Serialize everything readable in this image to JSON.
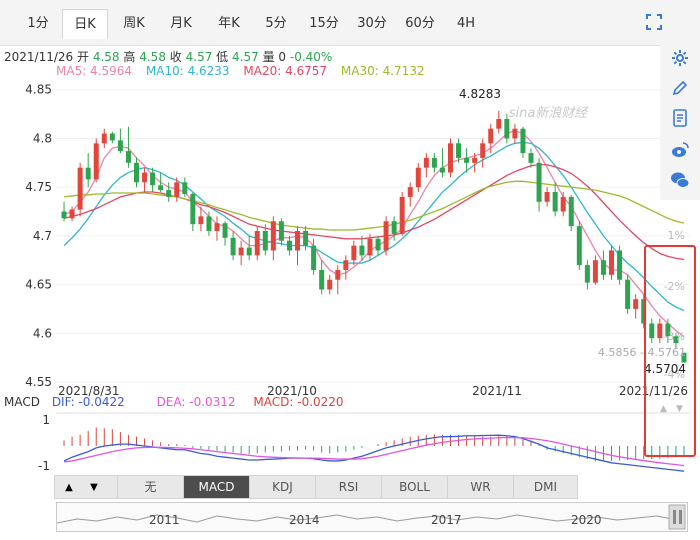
{
  "tabs": [
    {
      "label": "1分",
      "active": false
    },
    {
      "label": "日K",
      "active": true
    },
    {
      "label": "周K",
      "active": false
    },
    {
      "label": "月K",
      "active": false
    },
    {
      "label": "年K",
      "active": false
    },
    {
      "label": "5分",
      "active": false
    },
    {
      "label": "15分",
      "active": false
    },
    {
      "label": "30分",
      "active": false
    },
    {
      "label": "60分",
      "active": false
    },
    {
      "label": "4H",
      "active": false
    }
  ],
  "info": {
    "date": "2021/11/26",
    "open_label": "开",
    "open": "4.58",
    "high_label": "高",
    "high": "4.58",
    "close_label": "收",
    "close": "4.57",
    "low_label": "低",
    "low": "4.57",
    "vol_label": "量",
    "vol": "0",
    "change": "-0.40%"
  },
  "ma_legend": [
    {
      "text": "MA5: 4.5964",
      "color": "#ee82a8"
    },
    {
      "text": "MA10: 4.6233",
      "color": "#2fb6d3"
    },
    {
      "text": "MA20: 4.6757",
      "color": "#e24763"
    },
    {
      "text": "MA30: 4.7132",
      "color": "#9bbb2c"
    }
  ],
  "sidebar_icons": [
    "settings-icon",
    "pencil-icon",
    "document-icon",
    "weibo-icon",
    "wechat-icon"
  ],
  "watermark": "sina新浪财经",
  "price_axis": {
    "ticks": [
      "4.85",
      "4.8",
      "4.75",
      "4.7",
      "4.65",
      "4.6",
      "4.55"
    ],
    "values": [
      4.85,
      4.8,
      4.75,
      4.7,
      4.65,
      4.6,
      4.55
    ]
  },
  "pct_labels": [
    "1%",
    "-2%",
    "-3%",
    "-4%"
  ],
  "date_labels": [
    "2021/8/31",
    "2021/10",
    "2021/11",
    "2021/11/26"
  ],
  "annotations": {
    "high": "4.8283",
    "low": "4.5704",
    "last": "4.5856 - 4.5761"
  },
  "macd_legend": {
    "title": "MACD",
    "dif": {
      "text": "DIF: -0.0422",
      "color": "#3a5bd9"
    },
    "dea": {
      "text": "DEA: -0.0312",
      "color": "#e055e0"
    },
    "macd": {
      "text": "MACD: -0.0220",
      "color": "#d9443a"
    }
  },
  "macd_axis": [
    "1",
    "-1"
  ],
  "indicator_tabs": [
    {
      "label": "无",
      "active": false
    },
    {
      "label": "MACD",
      "active": true
    },
    {
      "label": "KDJ",
      "active": false
    },
    {
      "label": "RSI",
      "active": false
    },
    {
      "label": "BOLL",
      "active": false
    },
    {
      "label": "WR",
      "active": false
    },
    {
      "label": "DMI",
      "active": false
    }
  ],
  "nav_buttons": [
    "▲",
    "▼"
  ],
  "navigator_years": [
    "2011",
    "2014",
    "2017",
    "2020"
  ],
  "chart_data": {
    "type": "candlestick",
    "ylim": [
      4.55,
      4.86
    ],
    "up_color": "#e0463c",
    "down_color": "#2ea44f",
    "candles": [
      {
        "o": 4.725,
        "h": 4.735,
        "l": 4.715,
        "c": 4.718
      },
      {
        "o": 4.718,
        "h": 4.73,
        "l": 4.715,
        "c": 4.727
      },
      {
        "o": 4.727,
        "h": 4.775,
        "l": 4.72,
        "c": 4.77
      },
      {
        "o": 4.77,
        "h": 4.785,
        "l": 4.75,
        "c": 4.758
      },
      {
        "o": 4.758,
        "h": 4.8,
        "l": 4.755,
        "c": 4.795
      },
      {
        "o": 4.795,
        "h": 4.81,
        "l": 4.79,
        "c": 4.805
      },
      {
        "o": 4.805,
        "h": 4.807,
        "l": 4.795,
        "c": 4.798
      },
      {
        "o": 4.798,
        "h": 4.81,
        "l": 4.785,
        "c": 4.787
      },
      {
        "o": 4.787,
        "h": 4.812,
        "l": 4.77,
        "c": 4.775
      },
      {
        "o": 4.775,
        "h": 4.78,
        "l": 4.75,
        "c": 4.755
      },
      {
        "o": 4.755,
        "h": 4.77,
        "l": 4.745,
        "c": 4.765
      },
      {
        "o": 4.765,
        "h": 4.77,
        "l": 4.745,
        "c": 4.752
      },
      {
        "o": 4.752,
        "h": 4.765,
        "l": 4.745,
        "c": 4.747
      },
      {
        "o": 4.747,
        "h": 4.755,
        "l": 4.735,
        "c": 4.74
      },
      {
        "o": 4.74,
        "h": 4.76,
        "l": 4.735,
        "c": 4.755
      },
      {
        "o": 4.755,
        "h": 4.76,
        "l": 4.74,
        "c": 4.743
      },
      {
        "o": 4.743,
        "h": 4.745,
        "l": 4.705,
        "c": 4.712
      },
      {
        "o": 4.712,
        "h": 4.73,
        "l": 4.705,
        "c": 4.72
      },
      {
        "o": 4.72,
        "h": 4.725,
        "l": 4.7,
        "c": 4.705
      },
      {
        "o": 4.705,
        "h": 4.72,
        "l": 4.695,
        "c": 4.713
      },
      {
        "o": 4.713,
        "h": 4.715,
        "l": 4.69,
        "c": 4.698
      },
      {
        "o": 4.698,
        "h": 4.705,
        "l": 4.675,
        "c": 4.68
      },
      {
        "o": 4.68,
        "h": 4.695,
        "l": 4.67,
        "c": 4.688
      },
      {
        "o": 4.688,
        "h": 4.7,
        "l": 4.675,
        "c": 4.68
      },
      {
        "o": 4.68,
        "h": 4.71,
        "l": 4.675,
        "c": 4.705
      },
      {
        "o": 4.705,
        "h": 4.712,
        "l": 4.68,
        "c": 4.685
      },
      {
        "o": 4.685,
        "h": 4.72,
        "l": 4.675,
        "c": 4.715
      },
      {
        "o": 4.715,
        "h": 4.718,
        "l": 4.69,
        "c": 4.695
      },
      {
        "o": 4.695,
        "h": 4.7,
        "l": 4.68,
        "c": 4.685
      },
      {
        "o": 4.685,
        "h": 4.71,
        "l": 4.67,
        "c": 4.705
      },
      {
        "o": 4.705,
        "h": 4.71,
        "l": 4.685,
        "c": 4.69
      },
      {
        "o": 4.69,
        "h": 4.697,
        "l": 4.66,
        "c": 4.665
      },
      {
        "o": 4.665,
        "h": 4.675,
        "l": 4.64,
        "c": 4.645
      },
      {
        "o": 4.645,
        "h": 4.66,
        "l": 4.64,
        "c": 4.655
      },
      {
        "o": 4.655,
        "h": 4.67,
        "l": 4.64,
        "c": 4.665
      },
      {
        "o": 4.665,
        "h": 4.68,
        "l": 4.655,
        "c": 4.675
      },
      {
        "o": 4.675,
        "h": 4.695,
        "l": 4.67,
        "c": 4.69
      },
      {
        "o": 4.69,
        "h": 4.7,
        "l": 4.675,
        "c": 4.68
      },
      {
        "o": 4.68,
        "h": 4.702,
        "l": 4.675,
        "c": 4.697
      },
      {
        "o": 4.697,
        "h": 4.7,
        "l": 4.68,
        "c": 4.685
      },
      {
        "o": 4.685,
        "h": 4.72,
        "l": 4.68,
        "c": 4.715
      },
      {
        "o": 4.715,
        "h": 4.72,
        "l": 4.695,
        "c": 4.702
      },
      {
        "o": 4.702,
        "h": 4.745,
        "l": 4.7,
        "c": 4.74
      },
      {
        "o": 4.74,
        "h": 4.755,
        "l": 4.73,
        "c": 4.75
      },
      {
        "o": 4.75,
        "h": 4.775,
        "l": 4.745,
        "c": 4.77
      },
      {
        "o": 4.77,
        "h": 4.785,
        "l": 4.76,
        "c": 4.78
      },
      {
        "o": 4.78,
        "h": 4.785,
        "l": 4.765,
        "c": 4.77
      },
      {
        "o": 4.77,
        "h": 4.79,
        "l": 4.76,
        "c": 4.765
      },
      {
        "o": 4.765,
        "h": 4.8,
        "l": 4.76,
        "c": 4.795
      },
      {
        "o": 4.795,
        "h": 4.8,
        "l": 4.775,
        "c": 4.78
      },
      {
        "o": 4.78,
        "h": 4.79,
        "l": 4.765,
        "c": 4.775
      },
      {
        "o": 4.775,
        "h": 4.785,
        "l": 4.765,
        "c": 4.78
      },
      {
        "o": 4.78,
        "h": 4.8,
        "l": 4.77,
        "c": 4.795
      },
      {
        "o": 4.795,
        "h": 4.815,
        "l": 4.785,
        "c": 4.81
      },
      {
        "o": 4.81,
        "h": 4.8283,
        "l": 4.805,
        "c": 4.82
      },
      {
        "o": 4.82,
        "h": 4.825,
        "l": 4.795,
        "c": 4.8
      },
      {
        "o": 4.8,
        "h": 4.815,
        "l": 4.795,
        "c": 4.81
      },
      {
        "o": 4.81,
        "h": 4.812,
        "l": 4.78,
        "c": 4.785
      },
      {
        "o": 4.785,
        "h": 4.79,
        "l": 4.77,
        "c": 4.775
      },
      {
        "o": 4.775,
        "h": 4.78,
        "l": 4.725,
        "c": 4.735
      },
      {
        "o": 4.735,
        "h": 4.75,
        "l": 4.73,
        "c": 4.745
      },
      {
        "o": 4.745,
        "h": 4.755,
        "l": 4.72,
        "c": 4.725
      },
      {
        "o": 4.725,
        "h": 4.745,
        "l": 4.72,
        "c": 4.74
      },
      {
        "o": 4.74,
        "h": 4.742,
        "l": 4.705,
        "c": 4.71
      },
      {
        "o": 4.71,
        "h": 4.715,
        "l": 4.665,
        "c": 4.67
      },
      {
        "o": 4.67,
        "h": 4.675,
        "l": 4.645,
        "c": 4.652
      },
      {
        "o": 4.652,
        "h": 4.68,
        "l": 4.65,
        "c": 4.675
      },
      {
        "o": 4.675,
        "h": 4.685,
        "l": 4.655,
        "c": 4.66
      },
      {
        "o": 4.66,
        "h": 4.69,
        "l": 4.655,
        "c": 4.685
      },
      {
        "o": 4.685,
        "h": 4.69,
        "l": 4.65,
        "c": 4.655
      },
      {
        "o": 4.655,
        "h": 4.66,
        "l": 4.62,
        "c": 4.625
      },
      {
        "o": 4.625,
        "h": 4.64,
        "l": 4.615,
        "c": 4.635
      },
      {
        "o": 4.635,
        "h": 4.64,
        "l": 4.605,
        "c": 4.61
      },
      {
        "o": 4.61,
        "h": 4.615,
        "l": 4.59,
        "c": 4.595
      },
      {
        "o": 4.595,
        "h": 4.615,
        "l": 4.59,
        "c": 4.61
      },
      {
        "o": 4.61,
        "h": 4.615,
        "l": 4.59,
        "c": 4.597
      },
      {
        "o": 4.597,
        "h": 4.6,
        "l": 4.585,
        "c": 4.59
      },
      {
        "o": 4.58,
        "h": 4.58,
        "l": 4.57,
        "c": 4.57
      }
    ],
    "ma_lines": [
      {
        "name": "MA5",
        "color": "#ee82a8",
        "values": [
          4.722,
          4.725,
          4.735,
          4.745,
          4.76,
          4.78,
          4.79,
          4.792,
          4.79,
          4.78,
          4.772,
          4.762,
          4.755,
          4.75,
          4.748,
          4.745,
          4.735,
          4.728,
          4.72,
          4.712,
          4.71,
          4.705,
          4.697,
          4.69,
          4.69,
          4.692,
          4.695,
          4.698,
          4.698,
          4.7,
          4.698,
          4.69,
          4.675,
          4.665,
          4.66,
          4.662,
          4.668,
          4.675,
          4.685,
          4.69,
          4.695,
          4.7,
          4.708,
          4.722,
          4.735,
          4.75,
          4.762,
          4.77,
          4.775,
          4.778,
          4.78,
          4.782,
          4.785,
          4.79,
          4.797,
          4.805,
          4.808,
          4.805,
          4.797,
          4.785,
          4.77,
          4.755,
          4.74,
          4.73,
          4.715,
          4.7,
          4.685,
          4.672,
          4.665,
          4.665,
          4.66,
          4.65,
          4.64,
          4.628,
          4.618,
          4.61,
          4.603,
          4.5964
        ]
      },
      {
        "name": "MA10",
        "color": "#2fb6d3",
        "values": [
          4.69,
          4.698,
          4.707,
          4.718,
          4.73,
          4.742,
          4.752,
          4.76,
          4.765,
          4.768,
          4.77,
          4.768,
          4.765,
          4.76,
          4.757,
          4.752,
          4.745,
          4.738,
          4.73,
          4.725,
          4.72,
          4.713,
          4.707,
          4.7,
          4.697,
          4.695,
          4.693,
          4.692,
          4.69,
          4.69,
          4.69,
          4.688,
          4.683,
          4.678,
          4.673,
          4.672,
          4.672,
          4.672,
          4.675,
          4.68,
          4.685,
          4.69,
          4.697,
          4.705,
          4.715,
          4.725,
          4.735,
          4.745,
          4.752,
          4.76,
          4.767,
          4.773,
          4.778,
          4.782,
          4.787,
          4.792,
          4.795,
          4.796,
          4.795,
          4.79,
          4.782,
          4.772,
          4.762,
          4.75,
          4.737,
          4.724,
          4.712,
          4.7,
          4.69,
          4.68,
          4.672,
          4.665,
          4.657,
          4.648,
          4.64,
          4.632,
          4.627,
          4.6233
        ]
      },
      {
        "name": "MA20",
        "color": "#e24763",
        "values": [
          4.718,
          4.72,
          4.722,
          4.725,
          4.728,
          4.732,
          4.736,
          4.74,
          4.742,
          4.744,
          4.745,
          4.745,
          4.744,
          4.742,
          4.74,
          4.738,
          4.735,
          4.732,
          4.73,
          4.727,
          4.724,
          4.72,
          4.716,
          4.712,
          4.71,
          4.708,
          4.706,
          4.705,
          4.704,
          4.703,
          4.702,
          4.701,
          4.7,
          4.699,
          4.698,
          4.697,
          4.697,
          4.697,
          4.698,
          4.699,
          4.7,
          4.701,
          4.703,
          4.706,
          4.709,
          4.713,
          4.717,
          4.722,
          4.727,
          4.732,
          4.737,
          4.742,
          4.747,
          4.752,
          4.757,
          4.762,
          4.766,
          4.769,
          4.772,
          4.773,
          4.773,
          4.771,
          4.768,
          4.764,
          4.758,
          4.751,
          4.743,
          4.734,
          4.725,
          4.716,
          4.708,
          4.7,
          4.693,
          4.687,
          4.682,
          4.679,
          4.677,
          4.6757
        ]
      },
      {
        "name": "MA30",
        "color": "#9bbb2c",
        "values": [
          4.74,
          4.741,
          4.742,
          4.742,
          4.743,
          4.743,
          4.744,
          4.744,
          4.744,
          4.744,
          4.744,
          4.743,
          4.742,
          4.741,
          4.74,
          4.738,
          4.736,
          4.734,
          4.732,
          4.729,
          4.727,
          4.724,
          4.722,
          4.719,
          4.717,
          4.715,
          4.713,
          4.711,
          4.71,
          4.709,
          4.708,
          4.707,
          4.707,
          4.706,
          4.706,
          4.706,
          4.706,
          4.707,
          4.708,
          4.709,
          4.71,
          4.712,
          4.714,
          4.716,
          4.719,
          4.722,
          4.725,
          4.728,
          4.732,
          4.736,
          4.74,
          4.744,
          4.748,
          4.751,
          4.753,
          4.755,
          4.756,
          4.756,
          4.755,
          4.754,
          4.753,
          4.752,
          4.751,
          4.75,
          4.749,
          4.748,
          4.747,
          4.745,
          4.743,
          4.741,
          4.738,
          4.734,
          4.73,
          4.726,
          4.722,
          4.718,
          4.715,
          4.7132
        ]
      }
    ],
    "macd": {
      "ylim": [
        -1.5,
        1.5
      ],
      "hist": [
        0.3,
        0.5,
        0.6,
        0.8,
        1.0,
        0.95,
        0.9,
        0.75,
        0.6,
        0.5,
        0.4,
        0.3,
        0.2,
        0.1,
        0.1,
        0.05,
        -0.1,
        -0.15,
        -0.2,
        -0.25,
        -0.3,
        -0.35,
        -0.4,
        -0.45,
        -0.4,
        -0.35,
        -0.3,
        -0.3,
        -0.25,
        -0.25,
        -0.2,
        -0.25,
        -0.35,
        -0.4,
        -0.35,
        -0.3,
        -0.2,
        -0.1,
        0.0,
        0.1,
        0.2,
        0.3,
        0.4,
        0.5,
        0.55,
        0.6,
        0.62,
        0.6,
        0.6,
        0.58,
        0.55,
        0.52,
        0.5,
        0.5,
        0.55,
        0.55,
        0.5,
        0.45,
        0.3,
        0.1,
        -0.2,
        -0.3,
        -0.4,
        -0.5,
        -0.6,
        -0.7,
        -0.8,
        -0.8,
        -0.8,
        -0.78,
        -0.75,
        -0.72,
        -0.7,
        -0.7,
        -0.68,
        -0.65,
        -0.62,
        -0.6
      ],
      "dif": [
        -0.8,
        -0.6,
        -0.45,
        -0.3,
        -0.1,
        0.0,
        0.05,
        0.1,
        0.1,
        0.05,
        0.0,
        -0.05,
        -0.1,
        -0.15,
        -0.2,
        -0.2,
        -0.3,
        -0.4,
        -0.45,
        -0.55,
        -0.6,
        -0.65,
        -0.7,
        -0.75,
        -0.75,
        -0.72,
        -0.7,
        -0.68,
        -0.65,
        -0.65,
        -0.65,
        -0.68,
        -0.75,
        -0.8,
        -0.8,
        -0.75,
        -0.65,
        -0.55,
        -0.4,
        -0.25,
        -0.1,
        0.0,
        0.1,
        0.2,
        0.3,
        0.38,
        0.45,
        0.5,
        0.5,
        0.52,
        0.55,
        0.55,
        0.56,
        0.57,
        0.58,
        0.55,
        0.5,
        0.4,
        0.25,
        0.1,
        -0.1,
        -0.2,
        -0.3,
        -0.4,
        -0.5,
        -0.6,
        -0.7,
        -0.8,
        -0.9,
        -0.95,
        -1.0,
        -1.05,
        -1.1,
        -1.15,
        -1.2,
        -1.25,
        -1.3,
        -1.35
      ],
      "dea": [
        -0.85,
        -0.8,
        -0.7,
        -0.6,
        -0.5,
        -0.4,
        -0.3,
        -0.22,
        -0.15,
        -0.1,
        -0.08,
        -0.07,
        -0.07,
        -0.08,
        -0.1,
        -0.12,
        -0.15,
        -0.2,
        -0.25,
        -0.3,
        -0.35,
        -0.4,
        -0.45,
        -0.5,
        -0.55,
        -0.58,
        -0.6,
        -0.62,
        -0.63,
        -0.64,
        -0.65,
        -0.65,
        -0.66,
        -0.68,
        -0.7,
        -0.7,
        -0.7,
        -0.68,
        -0.62,
        -0.55,
        -0.45,
        -0.35,
        -0.25,
        -0.15,
        -0.05,
        0.05,
        0.12,
        0.2,
        0.25,
        0.3,
        0.35,
        0.38,
        0.4,
        0.42,
        0.44,
        0.45,
        0.45,
        0.44,
        0.4,
        0.35,
        0.28,
        0.2,
        0.1,
        0.0,
        -0.1,
        -0.2,
        -0.3,
        -0.4,
        -0.5,
        -0.58,
        -0.65,
        -0.72,
        -0.78,
        -0.84,
        -0.9,
        -0.95,
        -1.0,
        -1.05
      ]
    }
  }
}
